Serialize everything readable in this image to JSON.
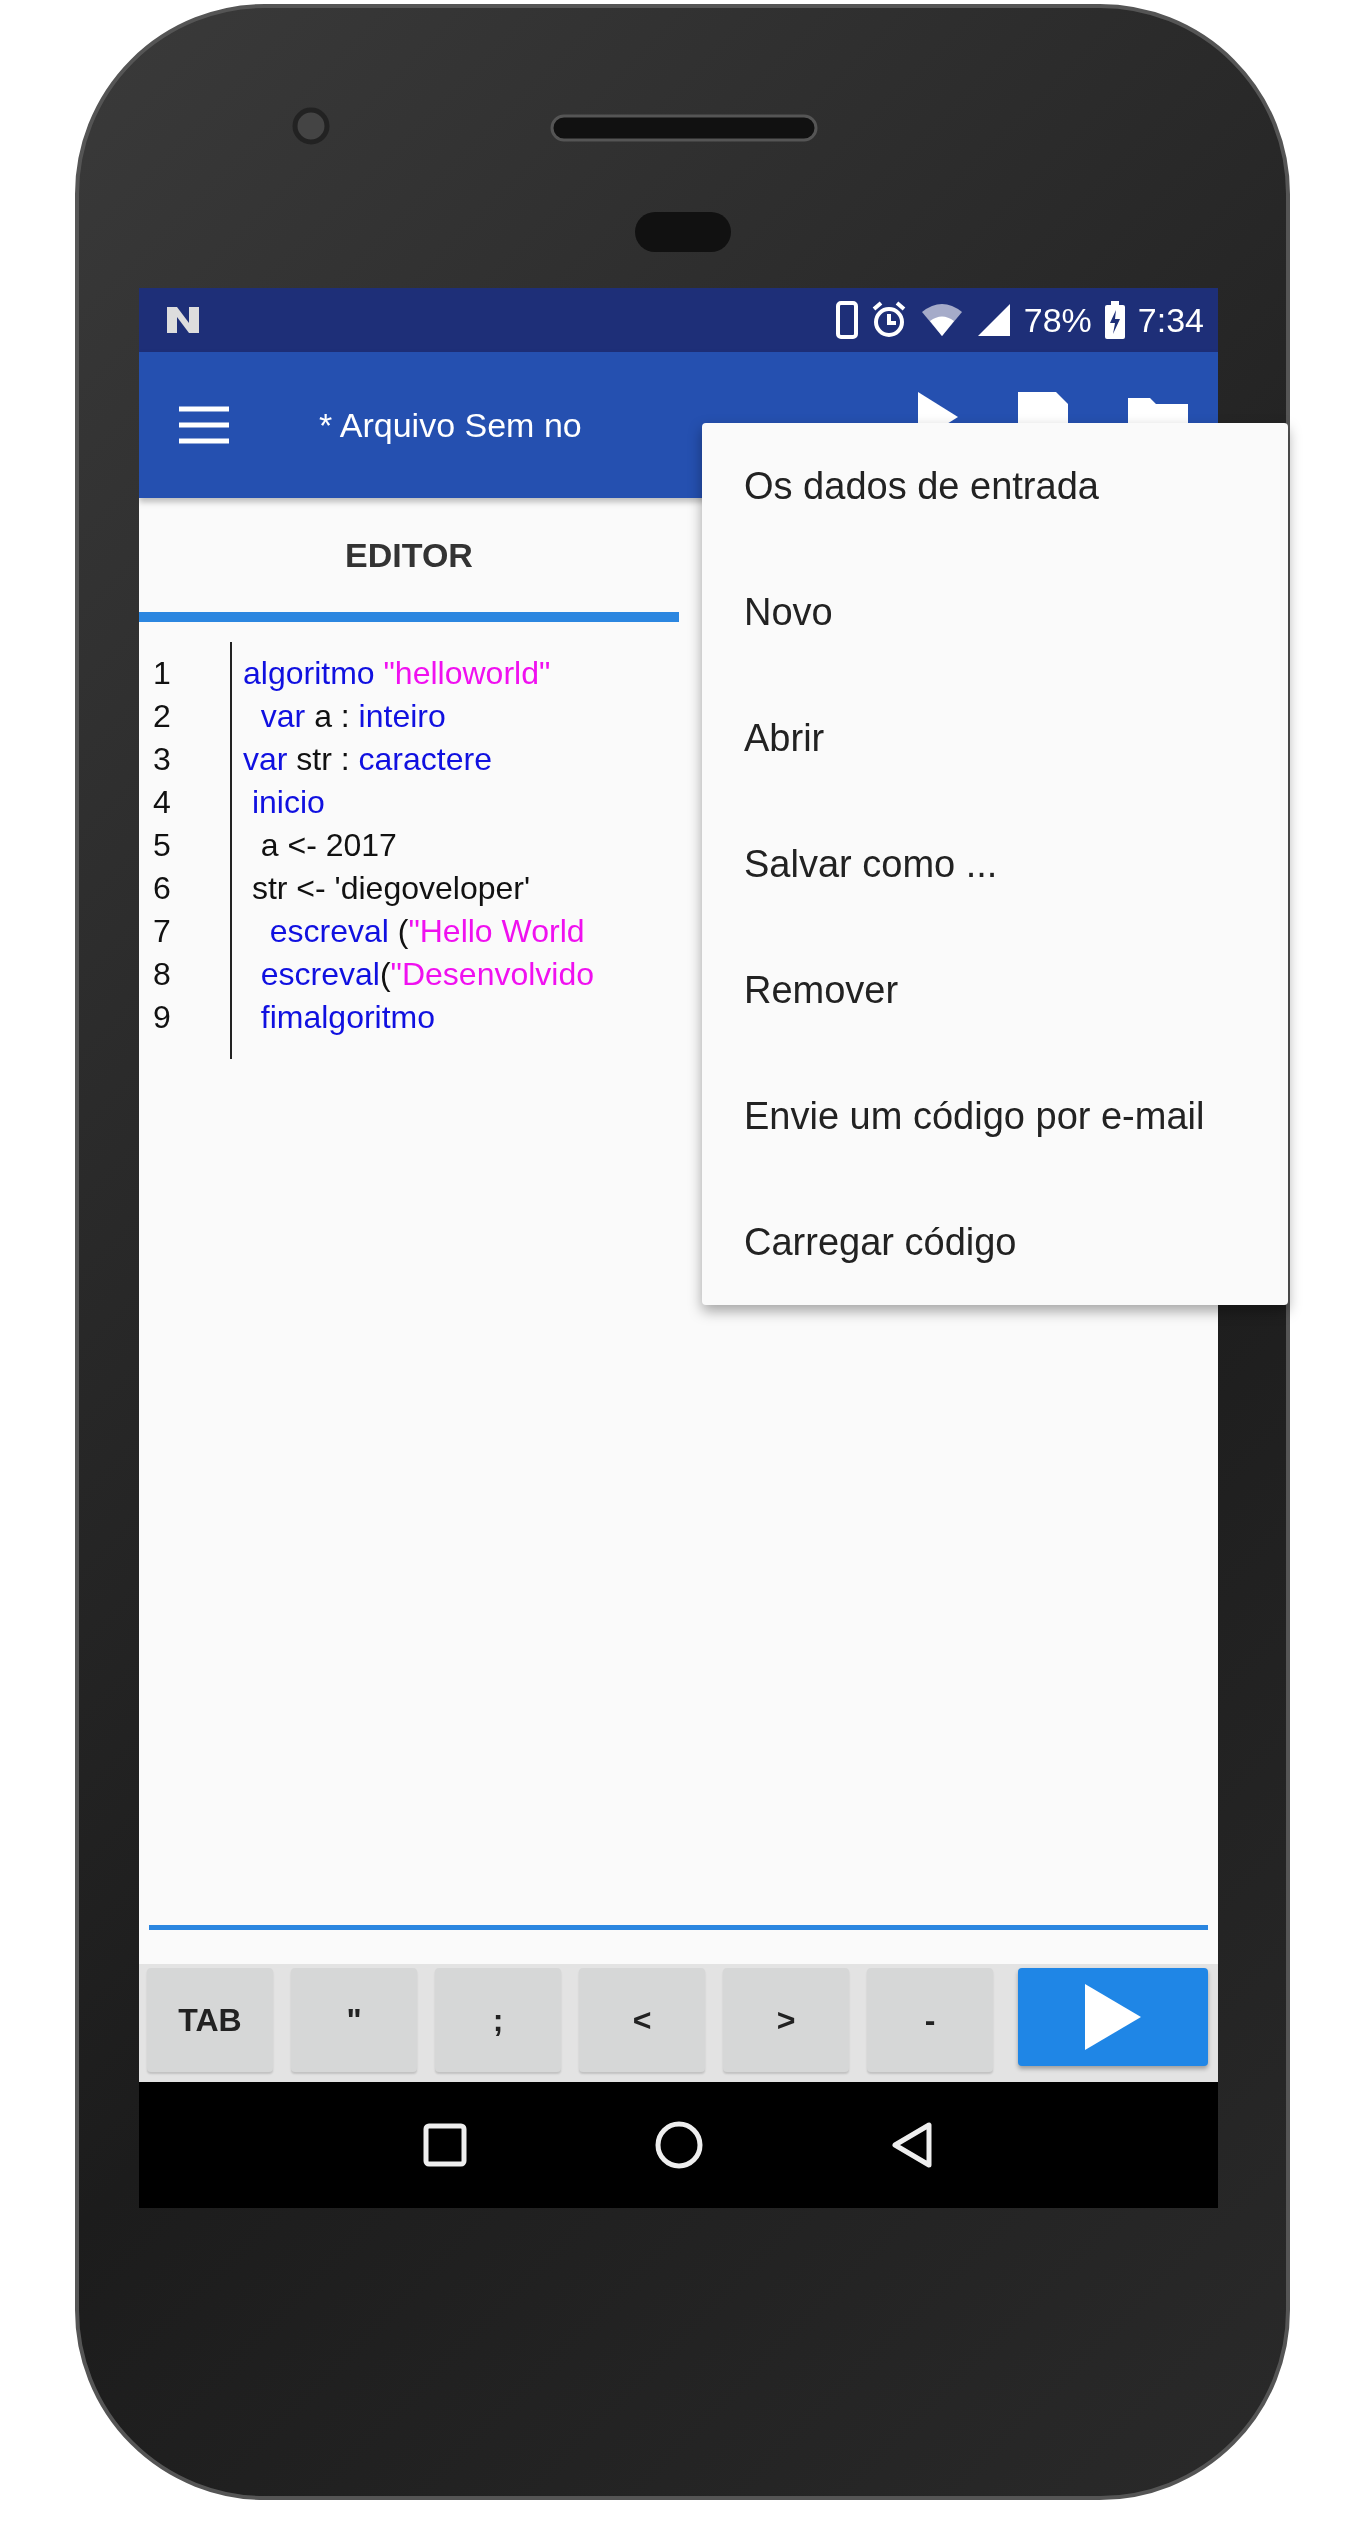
{
  "status_bar": {
    "battery": "78%",
    "time": "7:34"
  },
  "toolbar": {
    "title": "* Arquivo Sem no"
  },
  "tabs": [
    {
      "label": "EDITOR",
      "selected": true
    }
  ],
  "code": {
    "lines": [
      {
        "number": "1",
        "tokens": [
          {
            "kind": "keyword",
            "text": "algoritmo "
          },
          {
            "kind": "string",
            "text": "\"helloworld\""
          }
        ]
      },
      {
        "number": "2",
        "tokens": [
          {
            "kind": "keyword",
            "text": "  var"
          },
          {
            "kind": "plain",
            "text": " a : "
          },
          {
            "kind": "keyword",
            "text": "inteiro"
          }
        ]
      },
      {
        "number": "3",
        "tokens": [
          {
            "kind": "keyword",
            "text": "var"
          },
          {
            "kind": "plain",
            "text": " str : "
          },
          {
            "kind": "keyword",
            "text": "caractere"
          }
        ]
      },
      {
        "number": "4",
        "tokens": [
          {
            "kind": "keyword",
            "text": " inicio"
          }
        ]
      },
      {
        "number": "5",
        "tokens": [
          {
            "kind": "plain",
            "text": "  a <- 2017"
          }
        ]
      },
      {
        "number": "6",
        "tokens": [
          {
            "kind": "plain",
            "text": " str <- 'diegoveloper'"
          }
        ]
      },
      {
        "number": "7",
        "tokens": [
          {
            "kind": "keyword",
            "text": "   escreval"
          },
          {
            "kind": "plain",
            "text": " ("
          },
          {
            "kind": "string",
            "text": "\"Hello World"
          }
        ]
      },
      {
        "number": "8",
        "tokens": [
          {
            "kind": "keyword",
            "text": "  escreval"
          },
          {
            "kind": "plain",
            "text": "("
          },
          {
            "kind": "string",
            "text": "\"Desenvolvido"
          }
        ]
      },
      {
        "number": "9",
        "tokens": [
          {
            "kind": "keyword",
            "text": "  fimalgoritmo"
          }
        ]
      }
    ]
  },
  "menu": {
    "items": [
      {
        "label": "Os dados de entrada"
      },
      {
        "label": "Novo"
      },
      {
        "label": "Abrir"
      },
      {
        "label": "Salvar como ..."
      },
      {
        "label": "Remover"
      },
      {
        "label": "Envie um código por e-mail"
      },
      {
        "label": "Carregar código"
      }
    ]
  },
  "keys": [
    {
      "label": "TAB"
    },
    {
      "label": "\""
    },
    {
      "label": ";"
    },
    {
      "label": "<"
    },
    {
      "label": ">"
    },
    {
      "label": "-"
    }
  ]
}
